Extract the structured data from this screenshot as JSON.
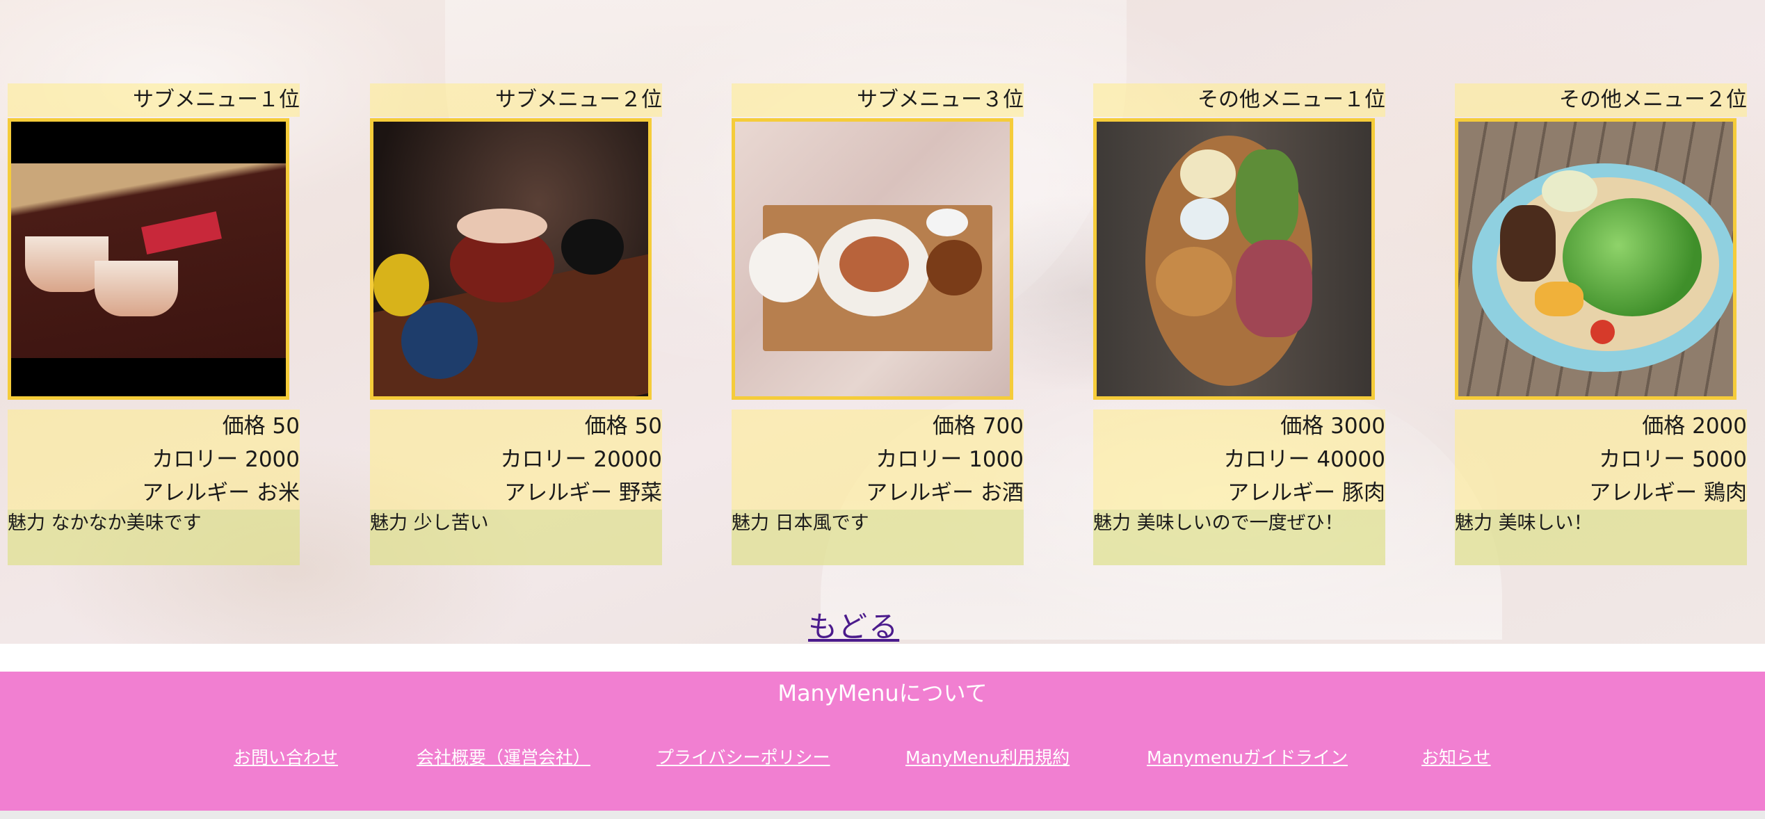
{
  "cards": [
    {
      "rank": "サブメニュー１位",
      "price": "価格 50",
      "calorie": "カロリー 2000",
      "allergy": "アレルギー お米",
      "charm": "魅力 なかなか美味です",
      "photo_icon": "drinks-photo"
    },
    {
      "rank": "サブメニュー２位",
      "price": "価格 50",
      "calorie": "カロリー 20000",
      "allergy": "アレルギー 野菜",
      "charm": "魅力 少し苦い",
      "photo_icon": "seafood-bowl-photo"
    },
    {
      "rank": "サブメニュー３位",
      "price": "価格 700",
      "calorie": "カロリー 1000",
      "allergy": "アレルギー お酒",
      "charm": "魅力 日本風です",
      "photo_icon": "japanese-set-meal-photo"
    },
    {
      "rank": "その他メニュー１位",
      "price": "価格 3000",
      "calorie": "カロリー 40000",
      "allergy": "アレルギー 豚肉",
      "charm": "魅力 美味しいので一度ぜひ！",
      "photo_icon": "meat-platter-photo"
    },
    {
      "rank": "その他メニュー２位",
      "price": "価格 2000",
      "calorie": "カロリー 5000",
      "allergy": "アレルギー 鶏肉",
      "charm": "魅力 美味しい！",
      "photo_icon": "salad-plate-photo"
    }
  ],
  "back_link": "もどる",
  "footer": {
    "title": "ManyMenuについて",
    "links": [
      "お問い合わせ",
      "会社概要（運営会社）",
      "プライバシーポリシー",
      "ManyMenu利用規約",
      "Manymenuガイドライン",
      "お知らせ"
    ]
  },
  "colors": {
    "card_bg": "#ffec8c",
    "photo_border": "#f5cc3a",
    "footer_bg": "#f17fd1",
    "link": "#4b1b8c"
  }
}
